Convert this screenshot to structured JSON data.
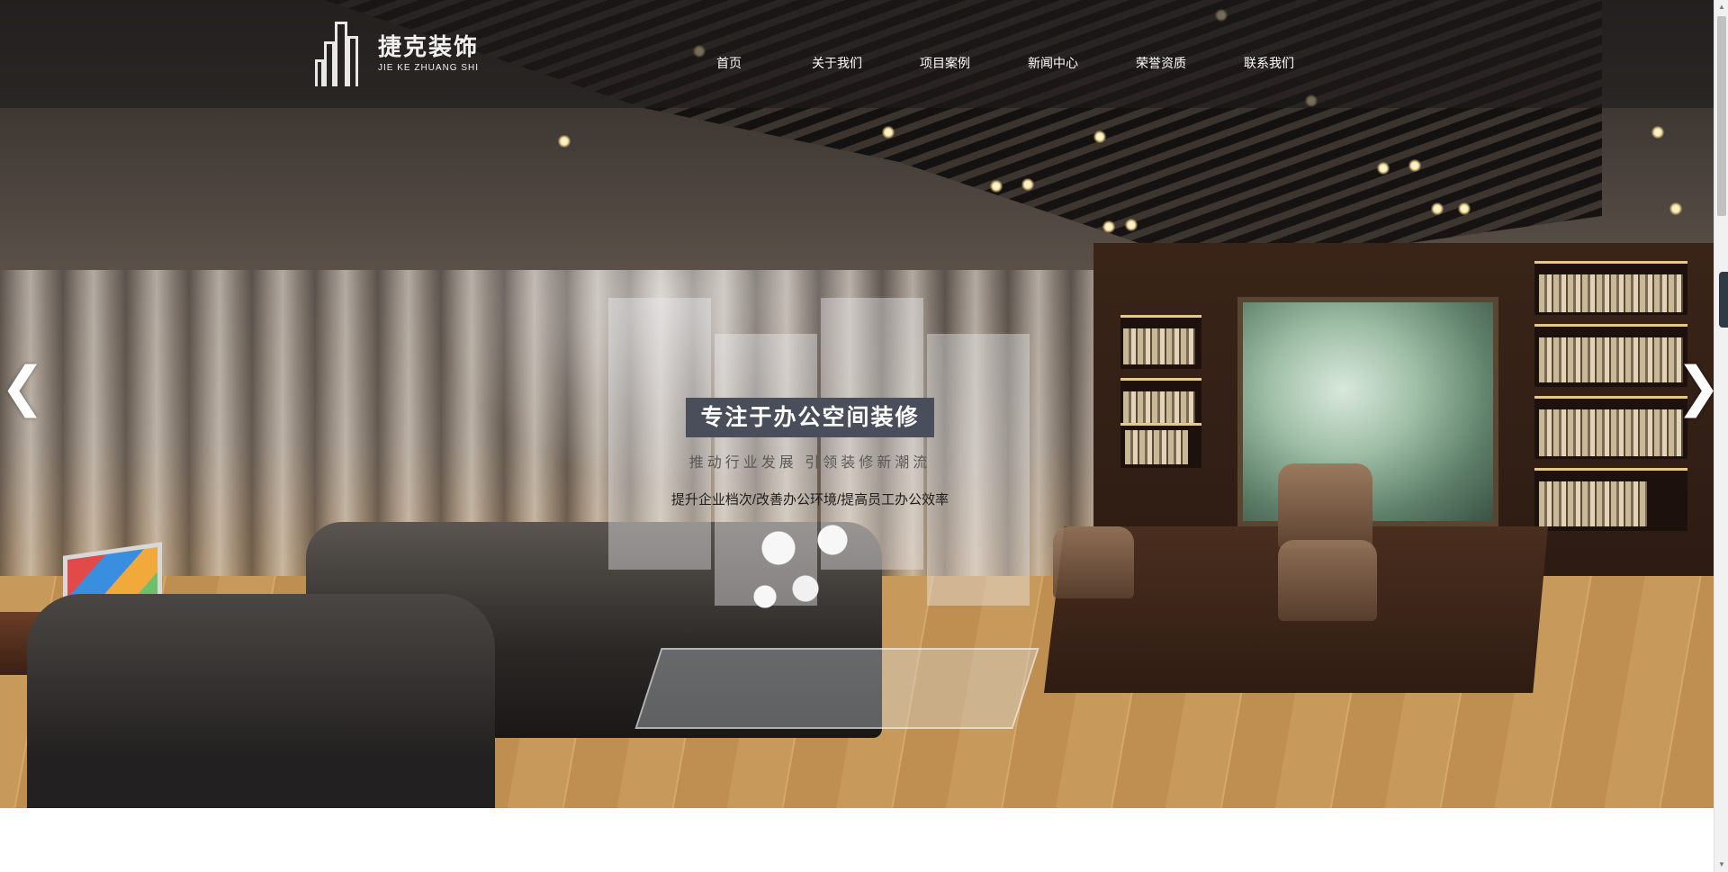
{
  "logo": {
    "name_cn": "捷克装饰",
    "name_en": "JIE KE ZHUANG SHI"
  },
  "nav": {
    "items": [
      "首页",
      "关于我们",
      "项目案例",
      "新闻中心",
      "荣誉资质",
      "联系我们"
    ]
  },
  "banner": {
    "headline": "专注于办公空间装修",
    "subline": "推动行业发展 引领装修新潮流",
    "tagline": "提升企业档次/改善办公环境/提高员工办公效率"
  },
  "controls": {
    "prev_icon": "chevron-left-icon",
    "next_icon": "chevron-right-icon",
    "prev_glyph": "❮",
    "next_glyph": "❯"
  },
  "colors": {
    "header_bg": "#1e1c1b",
    "headline_bg": "#4a4d5a",
    "text_white": "#ffffff"
  }
}
